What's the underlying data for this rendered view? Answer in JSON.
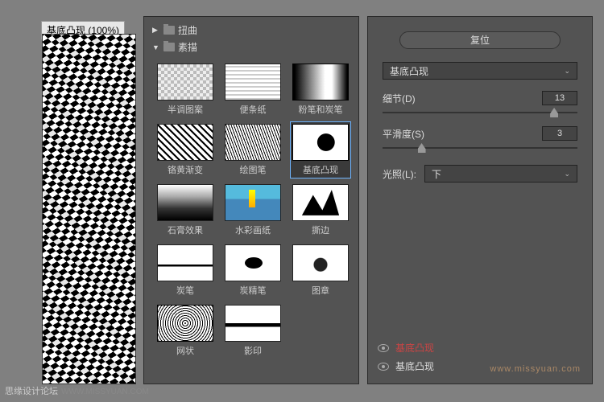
{
  "preview": {
    "tab_label": "基底凸现 (100%)"
  },
  "categories": {
    "collapsed": {
      "label": "扭曲"
    },
    "expanded": {
      "label": "素描"
    }
  },
  "filters": [
    {
      "label": "半调图案"
    },
    {
      "label": "便条纸"
    },
    {
      "label": "粉笔和炭笔"
    },
    {
      "label": "铬黄渐变"
    },
    {
      "label": "绘图笔"
    },
    {
      "label": "基底凸现",
      "selected": true
    },
    {
      "label": "石膏效果"
    },
    {
      "label": "水彩画纸"
    },
    {
      "label": "撕边"
    },
    {
      "label": "炭笔"
    },
    {
      "label": "炭精笔"
    },
    {
      "label": "图章"
    },
    {
      "label": "网状"
    },
    {
      "label": "影印"
    }
  ],
  "settings": {
    "reset_label": "复位",
    "filter_select": "基底凸现",
    "detail": {
      "label": "细节(D)",
      "value": "13",
      "pct": 86
    },
    "smooth": {
      "label": "平滑度(S)",
      "value": "3",
      "pct": 18
    },
    "light": {
      "label": "光照(L):",
      "value": "下"
    }
  },
  "layers": [
    {
      "label": "基底凸现",
      "red": true
    },
    {
      "label": "基底凸现",
      "red": false
    }
  ],
  "watermark": "www.missyuan.com",
  "footer": {
    "main": "思缘设计论坛",
    "sub": "WWW.MISSYUAN.COM"
  }
}
